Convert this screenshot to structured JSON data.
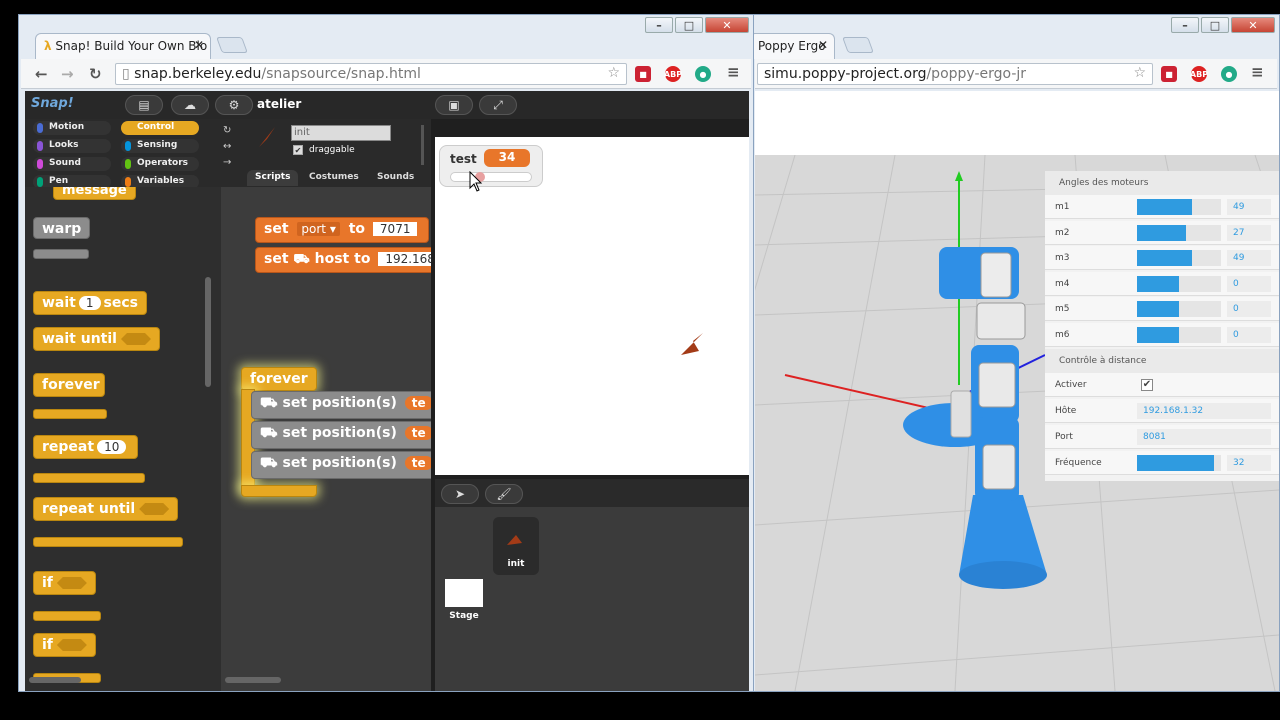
{
  "left_window": {
    "tab_title": "Snap! Build Your Own Blo",
    "url_host": "snap.berkeley.edu",
    "url_path": "/snapsource/snap.html",
    "controls": {
      "minimize": "–",
      "maximize": "□",
      "close": "✕"
    }
  },
  "right_window": {
    "tab_title": "Poppy Ergo",
    "url_host": "simu.poppy-project.org",
    "url_path": "/poppy-ergo-jr",
    "controls": {
      "minimize": "–",
      "maximize": "□",
      "close": "✕"
    }
  },
  "snap": {
    "logo": "Snap!",
    "project_name": "atelier",
    "categories": [
      {
        "label": "Motion",
        "color": "#4a6cd4"
      },
      {
        "label": "Control",
        "color": "#e6a822",
        "selected": true
      },
      {
        "label": "Looks",
        "color": "#8a55d7"
      },
      {
        "label": "Sensing",
        "color": "#0494dc"
      },
      {
        "label": "Sound",
        "color": "#cf4ad9"
      },
      {
        "label": "Operators",
        "color": "#62c213"
      },
      {
        "label": "Pen",
        "color": "#00a178"
      },
      {
        "label": "Variables",
        "color": "#ee7d16"
      }
    ],
    "sprite_name": "init",
    "draggable_label": "draggable",
    "tabs": [
      "Scripts",
      "Costumes",
      "Sounds"
    ],
    "palette": {
      "message": "message",
      "warp": "warp",
      "wait": "wait",
      "wait_value": "1",
      "secs": "secs",
      "wait_until": "wait until",
      "forever": "forever",
      "repeat": "repeat",
      "repeat_value": "10",
      "repeat_until": "repeat until",
      "if1": "if",
      "if2": "if"
    },
    "script": {
      "set1_label": "set",
      "set1_var": "port",
      "set1_to": "to",
      "set1_value": "7071",
      "set2_label": "set",
      "set2_host": "host to",
      "set2_value": "192.168",
      "forever": "forever",
      "pos1": "set position(s)",
      "pos2": "set position(s)",
      "pos3": "set position(s)",
      "pos_slot": "te"
    },
    "watcher": {
      "name": "test",
      "value": "34"
    },
    "corral": {
      "sprite_label": "init",
      "stage_label": "Stage"
    }
  },
  "poppy": {
    "motors_header": "Angles des moteurs",
    "motors": [
      {
        "name": "m1",
        "value": "49",
        "fill": 0.65
      },
      {
        "name": "m2",
        "value": "27",
        "fill": 0.58
      },
      {
        "name": "m3",
        "value": "49",
        "fill": 0.65
      },
      {
        "name": "m4",
        "value": "0",
        "fill": 0.5
      },
      {
        "name": "m5",
        "value": "0",
        "fill": 0.5
      },
      {
        "name": "m6",
        "value": "0",
        "fill": 0.5
      }
    ],
    "remote_header": "Contrôle à distance",
    "activer": "Activer",
    "hote_label": "Hôte",
    "hote_value": "192.168.1.32",
    "port_label": "Port",
    "port_value": "8081",
    "freq_label": "Fréquence",
    "freq_value": "32",
    "freq_fill": 0.92
  }
}
